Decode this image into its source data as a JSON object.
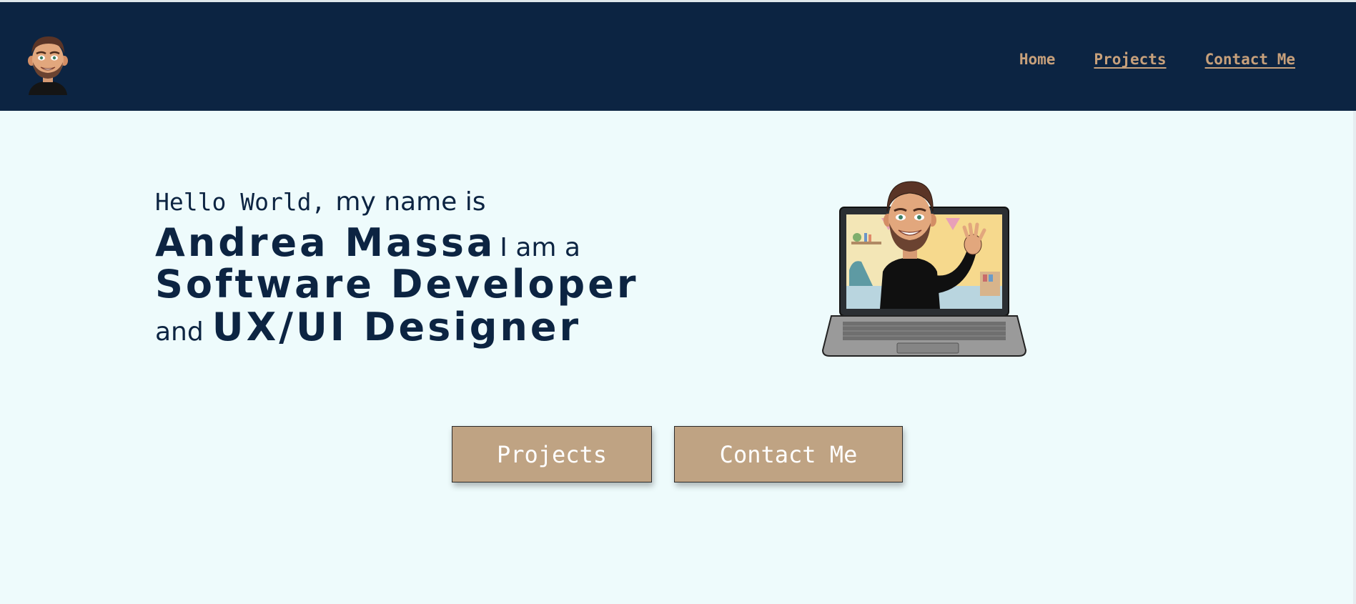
{
  "nav": {
    "logo_icon": "avatar-logo",
    "links": [
      {
        "label": "Home",
        "underlined": false
      },
      {
        "label": "Projects",
        "underlined": true
      },
      {
        "label": "Contact Me",
        "underlined": true
      }
    ],
    "link_color": "#c7a07b",
    "background": "#0c2442"
  },
  "hero": {
    "greeting": "Hello World,",
    "intro": "my name is",
    "name": "Andrea Massa",
    "separator": "I am a",
    "role1": "Software Developer",
    "conjunction": "and",
    "role2": "UX/UI Designer",
    "illustration_icon": "avatar-on-laptop-waving",
    "text_color": "#0c2442"
  },
  "cta": {
    "projects_label": "Projects",
    "contact_label": "Contact Me",
    "button_color": "#bfa383"
  },
  "page": {
    "background": "#eefbfc"
  }
}
